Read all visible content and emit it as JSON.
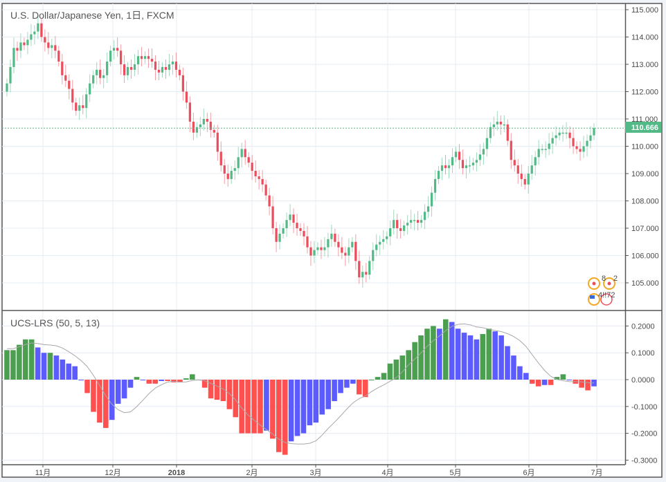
{
  "header": {
    "title": "U.S. Dollar/Japanese Yen, 1日, FXCM"
  },
  "indicator": {
    "title": "UCS-LRS (50, 5, 13)"
  },
  "colors": {
    "up": "#53b987",
    "down": "#eb4d5c",
    "hist_green": "#4c9f50",
    "hist_blue": "#5b5bff",
    "hist_red": "#ff5050",
    "signal": "#a8a8a8",
    "grid": "#e4ecf3",
    "last_price": "#53b987"
  },
  "event_markers": [
    "8",
    "2",
    "4!!72"
  ],
  "chart_data": [
    {
      "type": "candlestick",
      "title": "U.S. Dollar/Japanese Yen, 1日, FXCM",
      "ylim": [
        104.2,
        115.2
      ],
      "y_ticks": [
        "115.000",
        "114.000",
        "113.000",
        "112.000",
        "111.000",
        "110.000",
        "109.000",
        "108.000",
        "107.000",
        "106.000",
        "105.000"
      ],
      "last_price": "110.666",
      "x_ticks": [
        "11月",
        "12月",
        "2018",
        "2月",
        "3月",
        "4月",
        "5月",
        "6月",
        "7月"
      ],
      "close": [
        112.3,
        112.9,
        113.6,
        113.5,
        113.8,
        113.7,
        113.9,
        114.1,
        114.2,
        114.5,
        114.0,
        113.8,
        113.6,
        113.7,
        113.5,
        113.1,
        112.6,
        112.4,
        112.1,
        111.6,
        111.3,
        111.5,
        111.4,
        111.9,
        112.3,
        112.6,
        112.8,
        112.5,
        112.6,
        113.1,
        113.5,
        113.6,
        113.5,
        113.0,
        112.6,
        112.9,
        112.8,
        113.0,
        113.3,
        113.2,
        113.3,
        113.2,
        113.1,
        112.8,
        112.7,
        112.9,
        112.8,
        113.0,
        113.1,
        112.8,
        112.6,
        112.0,
        111.6,
        110.9,
        110.5,
        110.7,
        110.8,
        111.0,
        110.9,
        110.6,
        110.5,
        109.8,
        109.3,
        109.0,
        108.8,
        109.1,
        109.2,
        109.6,
        109.9,
        109.6,
        109.4,
        109.1,
        108.9,
        108.8,
        108.6,
        108.2,
        107.8,
        107.0,
        106.5,
        106.8,
        107.0,
        107.3,
        107.5,
        107.2,
        107.0,
        106.9,
        106.7,
        106.3,
        106.0,
        106.2,
        106.3,
        106.2,
        106.3,
        106.6,
        106.8,
        106.5,
        106.3,
        106.1,
        106.0,
        106.3,
        106.5,
        105.8,
        105.2,
        105.4,
        105.3,
        105.8,
        106.2,
        106.4,
        106.5,
        106.6,
        106.7,
        107.0,
        107.3,
        107.0,
        106.9,
        107.1,
        107.2,
        107.3,
        107.3,
        107.2,
        107.3,
        107.6,
        107.8,
        108.3,
        108.8,
        109.1,
        109.3,
        109.2,
        109.3,
        109.6,
        109.8,
        109.5,
        109.2,
        109.3,
        109.3,
        109.4,
        109.5,
        109.7,
        109.9,
        110.3,
        110.7,
        110.8,
        110.9,
        110.8,
        110.8,
        110.2,
        109.5,
        109.3,
        109.0,
        108.8,
        108.6,
        109.0,
        109.3,
        109.6,
        109.9,
        109.9,
        109.9,
        110.1,
        110.3,
        110.4,
        110.5,
        110.5,
        110.5,
        110.3,
        110.0,
        109.9,
        109.8,
        110.0,
        110.2,
        110.4,
        110.666
      ]
    },
    {
      "type": "bar",
      "title": "UCS-LRS (50, 5, 13)",
      "ylim": [
        -0.31,
        0.24
      ],
      "y_ticks": [
        "0.2000",
        "0.1000",
        "0.0000",
        "-0.1000",
        "-0.2000",
        "-0.3000"
      ],
      "values": [
        0.11,
        0.11,
        0.13,
        0.15,
        0.15,
        0.12,
        0.1,
        0.1,
        0.09,
        0.075,
        0.06,
        0.05,
        0.0,
        -0.05,
        -0.12,
        -0.16,
        -0.18,
        -0.15,
        -0.09,
        -0.07,
        -0.03,
        0.01,
        0.0,
        -0.015,
        -0.015,
        -0.005,
        -0.005,
        -0.01,
        -0.01,
        0.005,
        0.02,
        0.0,
        -0.03,
        -0.07,
        -0.075,
        -0.08,
        -0.11,
        -0.14,
        -0.2,
        -0.2,
        -0.2,
        -0.2,
        -0.19,
        -0.22,
        -0.27,
        -0.28,
        -0.23,
        -0.21,
        -0.2,
        -0.17,
        -0.16,
        -0.13,
        -0.11,
        -0.08,
        -0.05,
        -0.03,
        -0.015,
        -0.055,
        -0.065,
        0.0,
        0.01,
        0.025,
        0.06,
        0.075,
        0.09,
        0.11,
        0.14,
        0.165,
        0.19,
        0.2,
        0.19,
        0.225,
        0.215,
        0.19,
        0.175,
        0.165,
        0.15,
        0.17,
        0.19,
        0.18,
        0.165,
        0.125,
        0.09,
        0.05,
        0.025,
        -0.015,
        -0.025,
        -0.02,
        -0.02,
        0.01,
        0.02,
        0.0,
        -0.015,
        -0.03,
        -0.04,
        -0.025
      ],
      "signal_period": 7
    }
  ]
}
